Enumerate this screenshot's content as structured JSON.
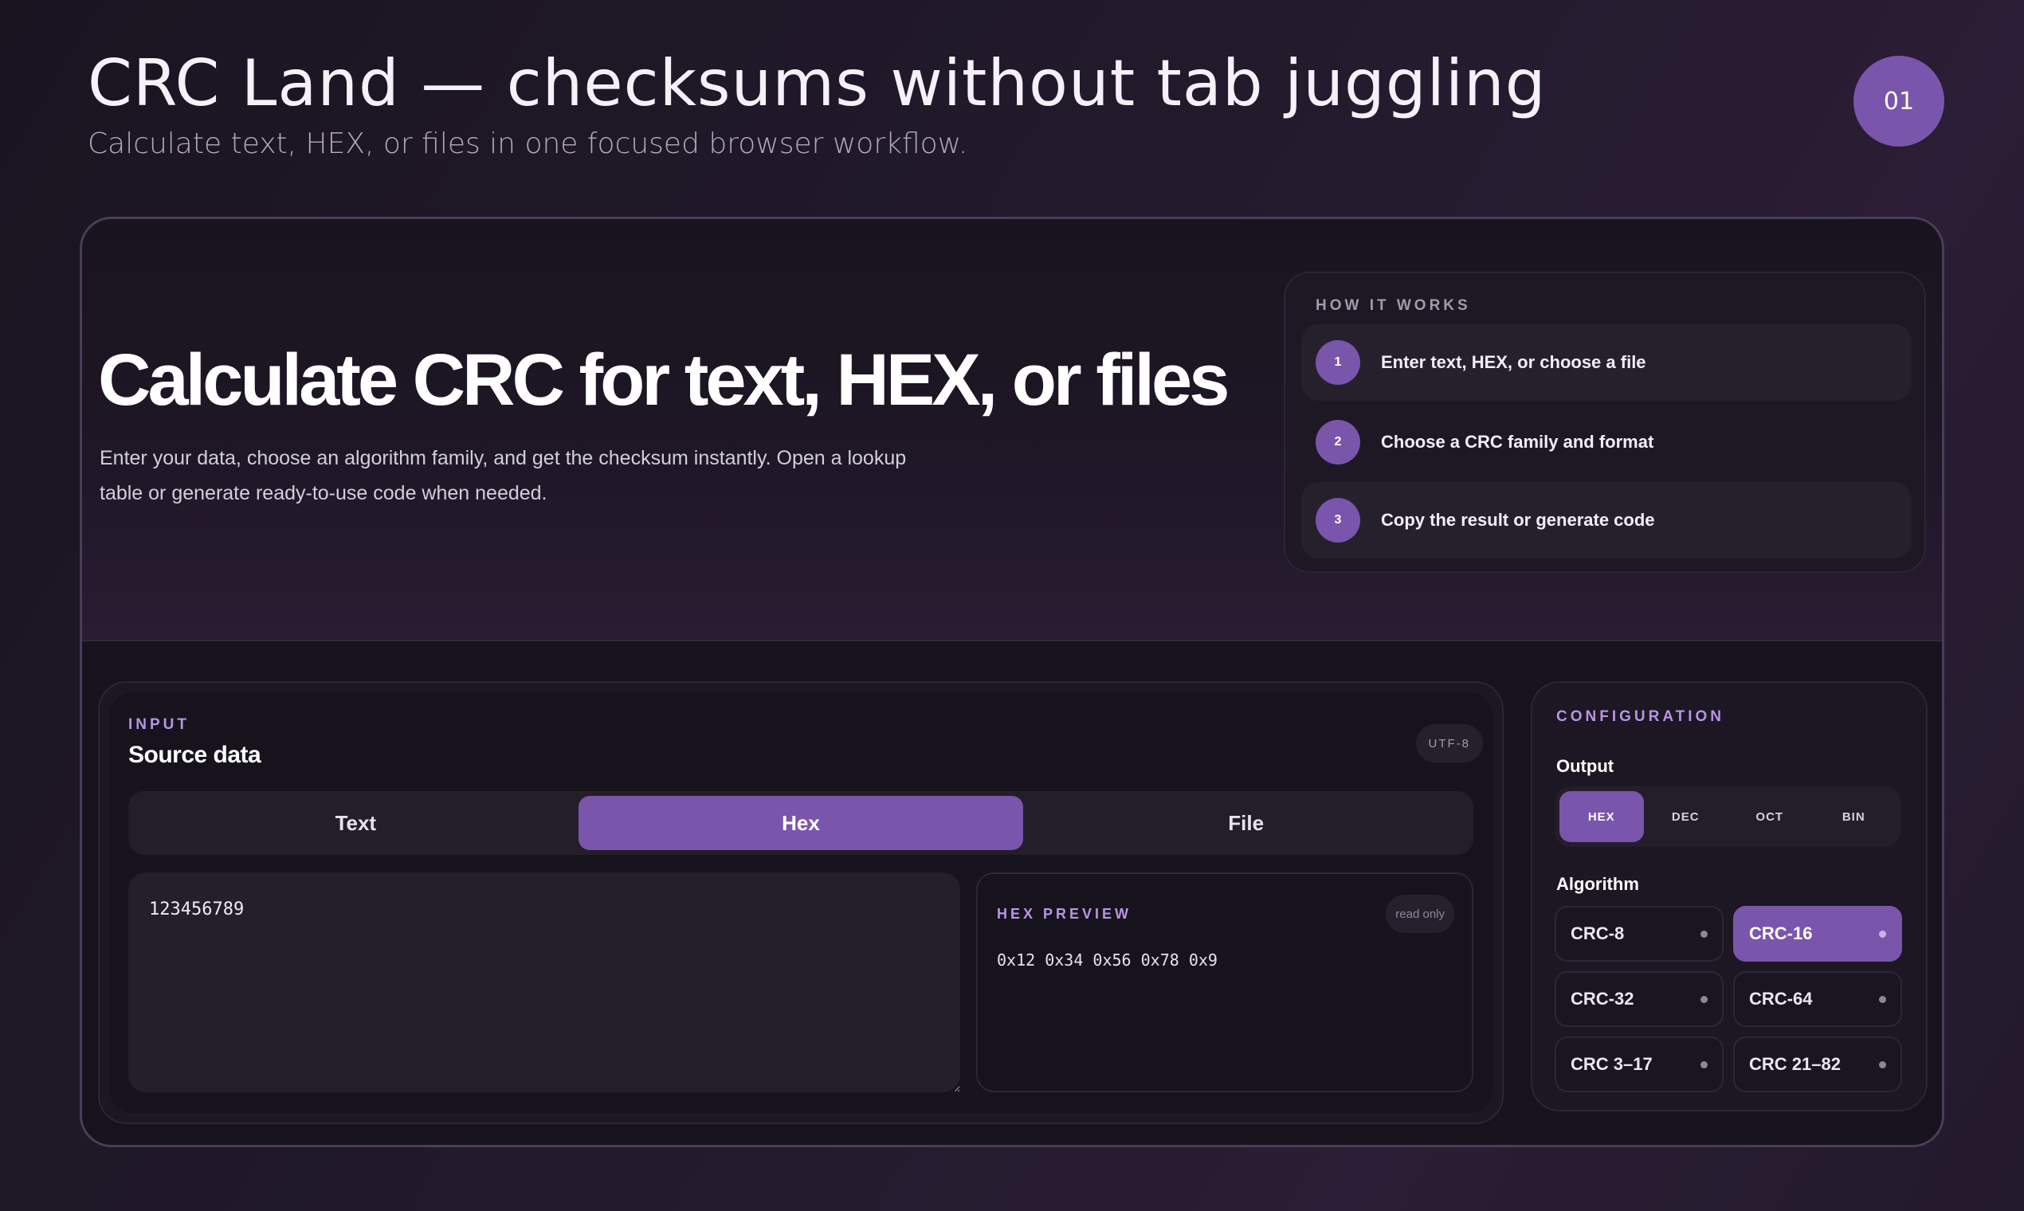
{
  "slide": {
    "title": "CRC Land — checksums without tab juggling",
    "subtitle": "Calculate text, HEX, or files in one focused browser workflow.",
    "page_number": "01"
  },
  "hero": {
    "title": "Calculate CRC for text, HEX, or files",
    "description": "Enter your data, choose an algorithm family, and get the checksum instantly. Open a lookup table or generate ready-to-use code when needed."
  },
  "how_it_works": {
    "label": "HOW IT WORKS",
    "steps": [
      {
        "number": "1",
        "text": "Enter text, HEX, or choose a file"
      },
      {
        "number": "2",
        "text": "Choose a CRC family and format"
      },
      {
        "number": "3",
        "text": "Copy the result or generate code"
      }
    ]
  },
  "input": {
    "label": "INPUT",
    "heading": "Source data",
    "encoding_badge": "UTF-8",
    "tabs": [
      {
        "label": "Text",
        "active": false
      },
      {
        "label": "Hex",
        "active": true
      },
      {
        "label": "File",
        "active": false
      }
    ],
    "value": "123456789",
    "preview": {
      "label": "HEX PREVIEW",
      "badge": "read only",
      "value": "0x12 0x34 0x56 0x78 0x9"
    }
  },
  "config": {
    "label": "CONFIGURATION",
    "output_label": "Output",
    "formats": [
      {
        "label": "HEX",
        "active": true
      },
      {
        "label": "DEC",
        "active": false
      },
      {
        "label": "OCT",
        "active": false
      },
      {
        "label": "BIN",
        "active": false
      }
    ],
    "algorithm_label": "Algorithm",
    "algorithms": [
      {
        "label": "CRC-8",
        "active": false
      },
      {
        "label": "CRC-16",
        "active": true
      },
      {
        "label": "CRC-32",
        "active": false
      },
      {
        "label": "CRC-64",
        "active": false
      },
      {
        "label": "CRC 3–17",
        "active": false
      },
      {
        "label": "CRC 21–82",
        "active": false
      }
    ]
  },
  "colors": {
    "accent": "#7a55ac",
    "accent_label": "#b894e6",
    "background": "#17131d"
  }
}
